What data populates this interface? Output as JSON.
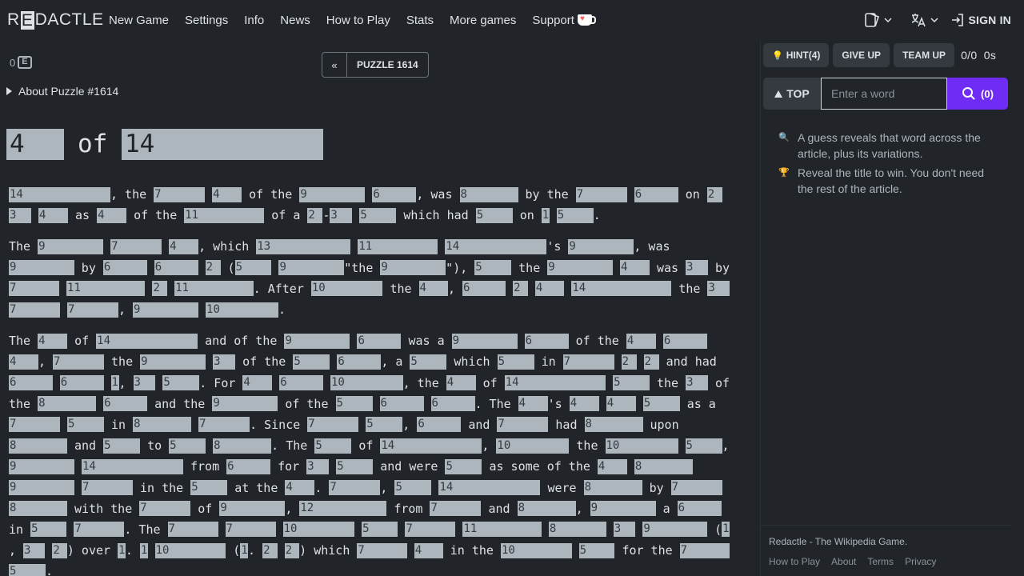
{
  "nav": {
    "logo_pre": "R",
    "logo_box": "E",
    "logo_post": "DACTLE",
    "items": [
      "New Game",
      "Settings",
      "Info",
      "News",
      "How to Play",
      "Stats",
      "More games",
      "Support"
    ],
    "signin": "SIGN IN"
  },
  "main": {
    "streak": "0",
    "prev": "«",
    "puzzle_label": "PUZZLE 1614",
    "about": "About Puzzle #1614",
    "title": {
      "b1": "4",
      "of": "of",
      "b2": "14"
    }
  },
  "sidebar": {
    "hint": "HINT(4)",
    "give_up": "GIVE UP",
    "team_up": "TEAM UP",
    "stats": "0/0  0s",
    "top": "TOP",
    "search_placeholder": "Enter a word",
    "search_count": "(0)",
    "tip1": "A guess reveals that word across the article, plus its variations.",
    "tip2": "Reveal the title to win. You don't need the rest of the article.",
    "footer_title": "Redactle - The Wikipedia Game.",
    "footer_links": [
      "How to Play",
      "About",
      "Terms",
      "Privacy"
    ]
  },
  "article": [
    [
      [
        [
          "14",
          14
        ],
        ", the",
        [
          "7",
          7
        ],
        [
          "4",
          4
        ],
        "of the",
        [
          "9",
          9
        ],
        [
          "6",
          6
        ],
        ", was",
        [
          "8",
          8
        ],
        "by the",
        [
          "7",
          7
        ],
        [
          "6",
          6
        ],
        "on",
        [
          "2",
          2
        ]
      ],
      [
        [
          "3",
          3
        ],
        [
          "4",
          4
        ],
        "as",
        [
          "4",
          4
        ],
        "of the",
        [
          "11",
          11
        ],
        "of a",
        [
          "2",
          2
        ],
        "-",
        [
          "3",
          3
        ],
        [
          "5",
          5
        ],
        "which had",
        [
          "5",
          5
        ],
        "on",
        [
          "1",
          1
        ],
        [
          "5",
          5
        ],
        "."
      ]
    ],
    [
      [
        "The",
        [
          "9",
          9
        ],
        [
          "7",
          7
        ],
        [
          "4",
          4
        ],
        ", which",
        [
          "13",
          13
        ],
        [
          "11",
          11
        ],
        [
          "14",
          14
        ],
        "'s",
        [
          "9",
          9
        ],
        ", was"
      ],
      [
        [
          "9",
          9
        ],
        "by",
        [
          "6",
          6
        ],
        [
          "6",
          6
        ],
        [
          "2",
          2
        ],
        "(",
        [
          "5",
          5
        ],
        [
          "9",
          9
        ],
        "\"the",
        [
          "9",
          9
        ],
        "\"),",
        [
          "5",
          5
        ],
        "the",
        [
          "9",
          9
        ],
        [
          "4",
          4
        ],
        "was",
        [
          "3",
          3
        ],
        "by"
      ],
      [
        [
          "7",
          7
        ],
        [
          "11",
          11
        ],
        [
          "2",
          2
        ],
        [
          "11",
          11
        ],
        ". After",
        [
          "10",
          10
        ],
        "the",
        [
          "4",
          4
        ],
        ",",
        [
          "6",
          6
        ],
        [
          "2",
          2
        ],
        [
          "4",
          4
        ],
        [
          "14",
          14
        ],
        "the",
        [
          "3",
          3
        ]
      ],
      [
        [
          "7",
          7
        ],
        [
          "7",
          7
        ],
        ",",
        [
          "9",
          9
        ],
        [
          "10",
          10
        ],
        "."
      ]
    ],
    [
      [
        "The",
        [
          "4",
          4
        ],
        "of",
        [
          "14",
          14
        ],
        "and of the",
        [
          "9",
          9
        ],
        [
          "6",
          6
        ],
        "was a",
        [
          "9",
          9
        ],
        [
          "6",
          6
        ],
        "of the",
        [
          "4",
          4
        ],
        [
          "6",
          6
        ]
      ],
      [
        [
          "4",
          4
        ],
        ",",
        [
          "7",
          7
        ],
        "the",
        [
          "9",
          9
        ],
        [
          "3",
          3
        ],
        "of the",
        [
          "5",
          5
        ],
        [
          "6",
          6
        ],
        ", a",
        [
          "5",
          5
        ],
        "which",
        [
          "5",
          5
        ],
        "in",
        [
          "7",
          7
        ],
        [
          "2",
          2
        ],
        [
          "2",
          2
        ],
        "and had"
      ],
      [
        [
          "6",
          6
        ],
        [
          "6",
          6
        ],
        [
          "1",
          1
        ],
        ",",
        [
          "3",
          3
        ],
        [
          "5",
          5
        ],
        ". For",
        [
          "4",
          4
        ],
        [
          "6",
          6
        ],
        [
          "10",
          10
        ],
        ", the",
        [
          "4",
          4
        ],
        "of",
        [
          "14",
          14
        ],
        [
          "5",
          5
        ],
        "the",
        [
          "3",
          3
        ],
        "of"
      ],
      [
        "the",
        [
          "8",
          8
        ],
        [
          "6",
          6
        ],
        "and the",
        [
          "9",
          9
        ],
        "of the",
        [
          "5",
          5
        ],
        [
          "6",
          6
        ],
        [
          "6",
          6
        ],
        ". The",
        [
          "4",
          4
        ],
        "'s",
        [
          "4",
          4
        ],
        [
          "4",
          4
        ],
        [
          "5",
          5
        ],
        "as a"
      ],
      [
        [
          "7",
          7
        ],
        [
          "5",
          5
        ],
        "in",
        [
          "8",
          8
        ],
        [
          "7",
          7
        ],
        ". Since",
        [
          "7",
          7
        ],
        [
          "5",
          5
        ],
        ",",
        [
          "6",
          6
        ],
        "and",
        [
          "7",
          7
        ],
        "had",
        [
          "8",
          8
        ],
        "upon"
      ],
      [
        [
          "8",
          8
        ],
        "and",
        [
          "5",
          5
        ],
        "to",
        [
          "5",
          5
        ],
        [
          "8",
          8
        ],
        ". The",
        [
          "5",
          5
        ],
        "of",
        [
          "14",
          14
        ],
        ",",
        [
          "10",
          10
        ],
        "the",
        [
          "10",
          10
        ],
        [
          "5",
          5
        ],
        ","
      ],
      [
        [
          "9",
          9
        ],
        [
          "14",
          14
        ],
        "from",
        [
          "6",
          6
        ],
        "for",
        [
          "3",
          3
        ],
        [
          "5",
          5
        ],
        "and were",
        [
          "5",
          5
        ],
        "as some of the",
        [
          "4",
          4
        ],
        [
          "8",
          8
        ]
      ],
      [
        [
          "9",
          9
        ],
        [
          "7",
          7
        ],
        "in the",
        [
          "5",
          5
        ],
        "at the",
        [
          "4",
          4
        ],
        ".",
        [
          "7",
          7
        ],
        ",",
        [
          "5",
          5
        ],
        [
          "14",
          14
        ],
        "were",
        [
          "8",
          8
        ],
        "by",
        [
          "7",
          7
        ]
      ],
      [
        [
          "8",
          8
        ],
        "with the",
        [
          "7",
          7
        ],
        "of",
        [
          "9",
          9
        ],
        ",",
        [
          "12",
          12
        ],
        "from",
        [
          "7",
          7
        ],
        "and",
        [
          "8",
          8
        ],
        ",",
        [
          "9",
          9
        ],
        "a",
        [
          "6",
          6
        ]
      ],
      [
        "in",
        [
          "5",
          5
        ],
        [
          "7",
          7
        ],
        ". The",
        [
          "7",
          7
        ],
        [
          "7",
          7
        ],
        [
          "10",
          10
        ],
        [
          "5",
          5
        ],
        [
          "7",
          7
        ],
        [
          "11",
          11
        ],
        [
          "8",
          8
        ],
        [
          "3",
          3
        ],
        [
          "9",
          9
        ],
        "(",
        [
          "1",
          1
        ]
      ],
      [
        ",",
        [
          "3",
          3
        ],
        [
          "2",
          2
        ],
        ") over",
        [
          "1",
          1
        ],
        ".",
        [
          "1",
          1
        ],
        [
          "10",
          10
        ],
        "(",
        [
          "1",
          1
        ],
        ".",
        [
          "2",
          2
        ],
        [
          "2",
          2
        ],
        ") which",
        [
          "7",
          7
        ],
        [
          "4",
          4
        ],
        "in the",
        [
          "10",
          10
        ],
        [
          "5",
          5
        ],
        "for the",
        [
          "7",
          7
        ]
      ],
      [
        [
          "5",
          5
        ],
        "."
      ]
    ]
  ]
}
